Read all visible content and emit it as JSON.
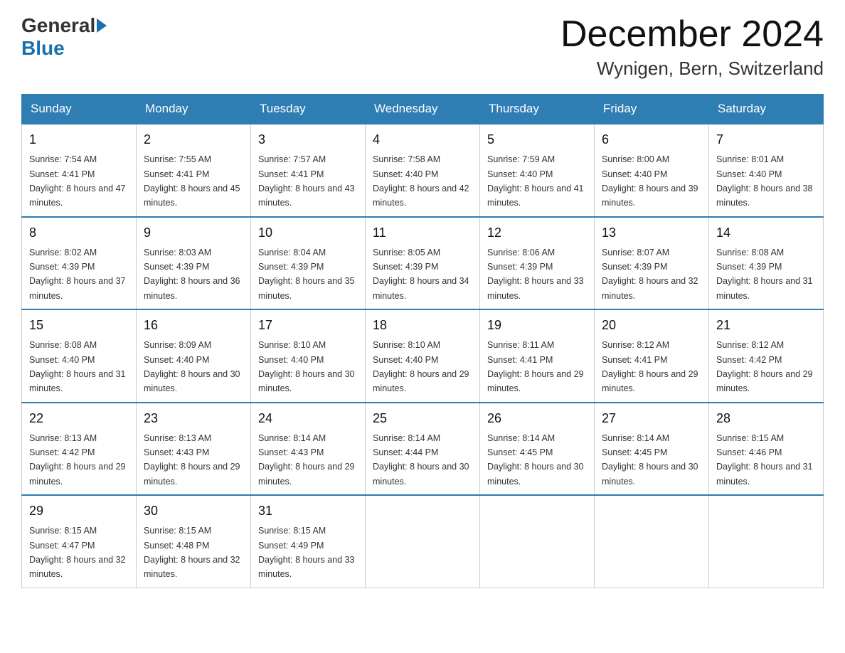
{
  "logo": {
    "general": "General",
    "blue": "Blue"
  },
  "header": {
    "title": "December 2024",
    "location": "Wynigen, Bern, Switzerland"
  },
  "weekdays": [
    "Sunday",
    "Monday",
    "Tuesday",
    "Wednesday",
    "Thursday",
    "Friday",
    "Saturday"
  ],
  "weeks": [
    [
      {
        "day": "1",
        "sunrise": "7:54 AM",
        "sunset": "4:41 PM",
        "daylight": "8 hours and 47 minutes."
      },
      {
        "day": "2",
        "sunrise": "7:55 AM",
        "sunset": "4:41 PM",
        "daylight": "8 hours and 45 minutes."
      },
      {
        "day": "3",
        "sunrise": "7:57 AM",
        "sunset": "4:41 PM",
        "daylight": "8 hours and 43 minutes."
      },
      {
        "day": "4",
        "sunrise": "7:58 AM",
        "sunset": "4:40 PM",
        "daylight": "8 hours and 42 minutes."
      },
      {
        "day": "5",
        "sunrise": "7:59 AM",
        "sunset": "4:40 PM",
        "daylight": "8 hours and 41 minutes."
      },
      {
        "day": "6",
        "sunrise": "8:00 AM",
        "sunset": "4:40 PM",
        "daylight": "8 hours and 39 minutes."
      },
      {
        "day": "7",
        "sunrise": "8:01 AM",
        "sunset": "4:40 PM",
        "daylight": "8 hours and 38 minutes."
      }
    ],
    [
      {
        "day": "8",
        "sunrise": "8:02 AM",
        "sunset": "4:39 PM",
        "daylight": "8 hours and 37 minutes."
      },
      {
        "day": "9",
        "sunrise": "8:03 AM",
        "sunset": "4:39 PM",
        "daylight": "8 hours and 36 minutes."
      },
      {
        "day": "10",
        "sunrise": "8:04 AM",
        "sunset": "4:39 PM",
        "daylight": "8 hours and 35 minutes."
      },
      {
        "day": "11",
        "sunrise": "8:05 AM",
        "sunset": "4:39 PM",
        "daylight": "8 hours and 34 minutes."
      },
      {
        "day": "12",
        "sunrise": "8:06 AM",
        "sunset": "4:39 PM",
        "daylight": "8 hours and 33 minutes."
      },
      {
        "day": "13",
        "sunrise": "8:07 AM",
        "sunset": "4:39 PM",
        "daylight": "8 hours and 32 minutes."
      },
      {
        "day": "14",
        "sunrise": "8:08 AM",
        "sunset": "4:39 PM",
        "daylight": "8 hours and 31 minutes."
      }
    ],
    [
      {
        "day": "15",
        "sunrise": "8:08 AM",
        "sunset": "4:40 PM",
        "daylight": "8 hours and 31 minutes."
      },
      {
        "day": "16",
        "sunrise": "8:09 AM",
        "sunset": "4:40 PM",
        "daylight": "8 hours and 30 minutes."
      },
      {
        "day": "17",
        "sunrise": "8:10 AM",
        "sunset": "4:40 PM",
        "daylight": "8 hours and 30 minutes."
      },
      {
        "day": "18",
        "sunrise": "8:10 AM",
        "sunset": "4:40 PM",
        "daylight": "8 hours and 29 minutes."
      },
      {
        "day": "19",
        "sunrise": "8:11 AM",
        "sunset": "4:41 PM",
        "daylight": "8 hours and 29 minutes."
      },
      {
        "day": "20",
        "sunrise": "8:12 AM",
        "sunset": "4:41 PM",
        "daylight": "8 hours and 29 minutes."
      },
      {
        "day": "21",
        "sunrise": "8:12 AM",
        "sunset": "4:42 PM",
        "daylight": "8 hours and 29 minutes."
      }
    ],
    [
      {
        "day": "22",
        "sunrise": "8:13 AM",
        "sunset": "4:42 PM",
        "daylight": "8 hours and 29 minutes."
      },
      {
        "day": "23",
        "sunrise": "8:13 AM",
        "sunset": "4:43 PM",
        "daylight": "8 hours and 29 minutes."
      },
      {
        "day": "24",
        "sunrise": "8:14 AM",
        "sunset": "4:43 PM",
        "daylight": "8 hours and 29 minutes."
      },
      {
        "day": "25",
        "sunrise": "8:14 AM",
        "sunset": "4:44 PM",
        "daylight": "8 hours and 30 minutes."
      },
      {
        "day": "26",
        "sunrise": "8:14 AM",
        "sunset": "4:45 PM",
        "daylight": "8 hours and 30 minutes."
      },
      {
        "day": "27",
        "sunrise": "8:14 AM",
        "sunset": "4:45 PM",
        "daylight": "8 hours and 30 minutes."
      },
      {
        "day": "28",
        "sunrise": "8:15 AM",
        "sunset": "4:46 PM",
        "daylight": "8 hours and 31 minutes."
      }
    ],
    [
      {
        "day": "29",
        "sunrise": "8:15 AM",
        "sunset": "4:47 PM",
        "daylight": "8 hours and 32 minutes."
      },
      {
        "day": "30",
        "sunrise": "8:15 AM",
        "sunset": "4:48 PM",
        "daylight": "8 hours and 32 minutes."
      },
      {
        "day": "31",
        "sunrise": "8:15 AM",
        "sunset": "4:49 PM",
        "daylight": "8 hours and 33 minutes."
      },
      null,
      null,
      null,
      null
    ]
  ]
}
